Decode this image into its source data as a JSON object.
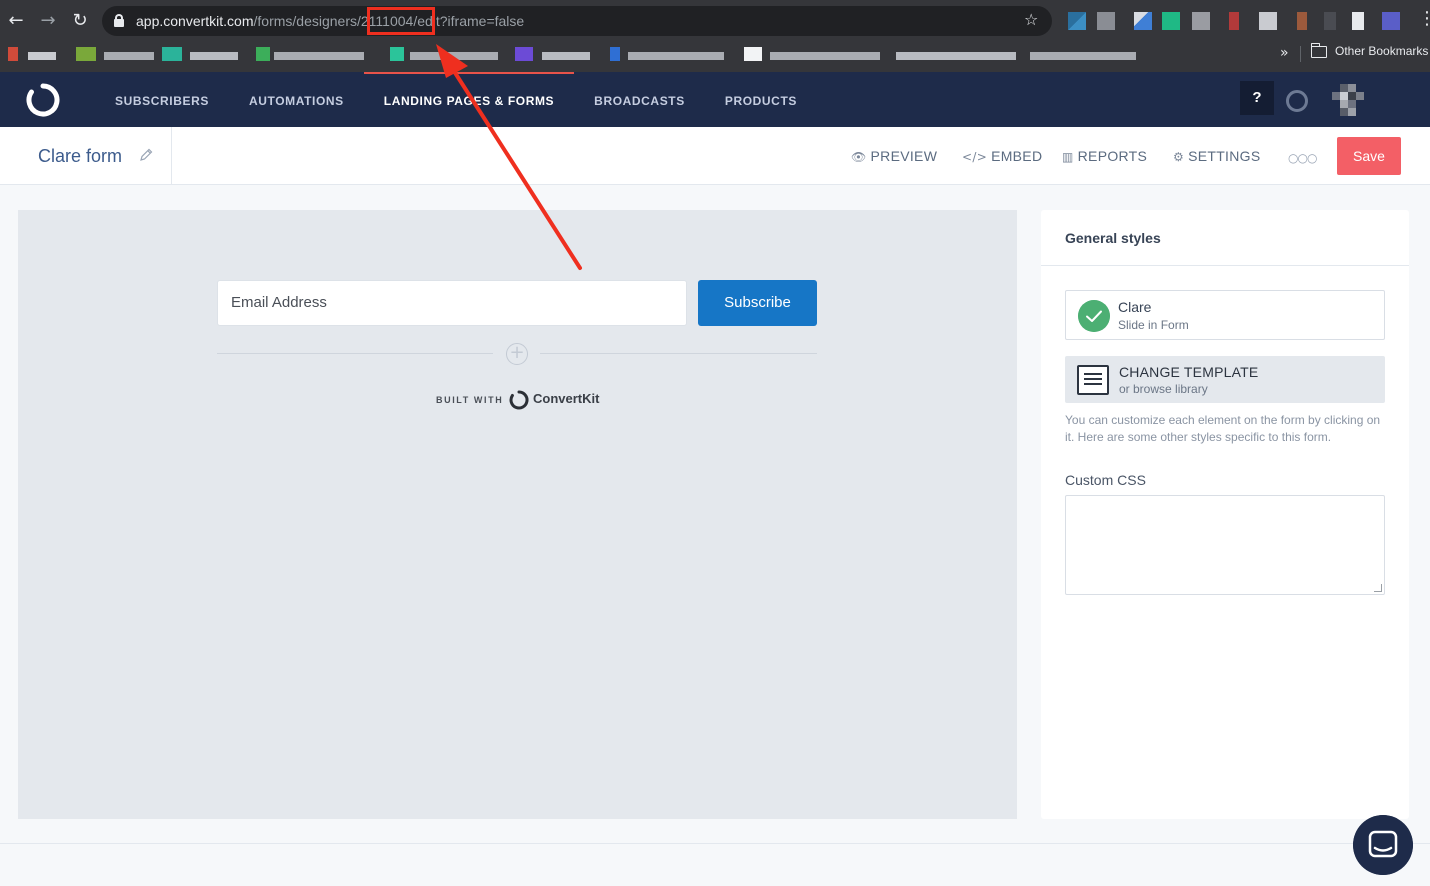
{
  "browser": {
    "url_host": "app.convertkit.com",
    "url_path_before": "/forms/designers/",
    "url_id": "2111004",
    "url_path_after": "/edit?iframe=false",
    "other_bookmarks": "Other Bookmarks",
    "chevron": "»"
  },
  "nav": {
    "items": [
      {
        "label": "SUBSCRIBERS",
        "active": false
      },
      {
        "label": "AUTOMATIONS",
        "active": false
      },
      {
        "label": "LANDING PAGES & FORMS",
        "active": true
      },
      {
        "label": "BROADCASTS",
        "active": false
      },
      {
        "label": "PRODUCTS",
        "active": false
      }
    ],
    "help_label": "?"
  },
  "form_header": {
    "title": "Clare form",
    "preview": "PREVIEW",
    "embed": "EMBED",
    "reports": "REPORTS",
    "settings": "SETTINGS",
    "save": "Save"
  },
  "canvas": {
    "email_placeholder": "Email Address",
    "subscribe_label": "Subscribe",
    "built_with": "BUILT WITH",
    "brand": "ConvertKit"
  },
  "sidebar": {
    "title": "General styles",
    "template_name": "Clare",
    "template_type": "Slide in Form",
    "change_template": "CHANGE TEMPLATE",
    "browse_library": "or browse library",
    "help_text": "You can customize each element on the form by clicking on it. Here are some other styles specific to this form.",
    "custom_css_label": "Custom CSS"
  },
  "colors": {
    "nav_bg": "#1e2b4a",
    "accent_red": "#f35f66",
    "subscribe_blue": "#1676c6",
    "check_green": "#4caf73",
    "annotation_red": "#ef2f1f"
  }
}
